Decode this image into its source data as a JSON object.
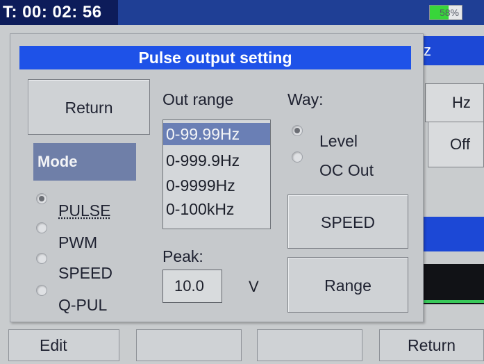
{
  "status": {
    "timer": "T: 00: 02: 56",
    "battery": "58%",
    "battery_level": 0.58
  },
  "background": {
    "blue_fragment": "z",
    "unit_box": "Hz",
    "state_box": "Off"
  },
  "dialog": {
    "title": "Pulse output setting",
    "return_button": "Return",
    "mode_label": "Mode",
    "modes": [
      {
        "label": "PULSE",
        "selected": true
      },
      {
        "label": "PWM",
        "selected": false
      },
      {
        "label": "SPEED",
        "selected": false
      },
      {
        "label": "Q-PUL",
        "selected": false
      }
    ],
    "out_range_label": "Out range",
    "ranges": [
      {
        "label": "0-99.99Hz",
        "selected": true
      },
      {
        "label": "0-999.9Hz",
        "selected": false
      },
      {
        "label": "0-9999Hz",
        "selected": false
      },
      {
        "label": "0-100kHz",
        "selected": false
      }
    ],
    "way_label": "Way:",
    "ways": [
      {
        "label": "Level",
        "selected": true
      },
      {
        "label": "OC Out",
        "selected": false
      }
    ],
    "peak_label": "Peak:",
    "peak_value": "10.0",
    "peak_unit": "V",
    "speed_button": "SPEED",
    "range_button": "Range"
  },
  "softkeys": [
    "Edit",
    "",
    "",
    "Return"
  ],
  "colors": {
    "title_bar": "#1e52e8",
    "status_bar": "#1f3f95",
    "mode_label_bg": "#6f7fa8",
    "selected_range_bg": "#6a7fb5",
    "battery_fill": "#38d63a"
  }
}
